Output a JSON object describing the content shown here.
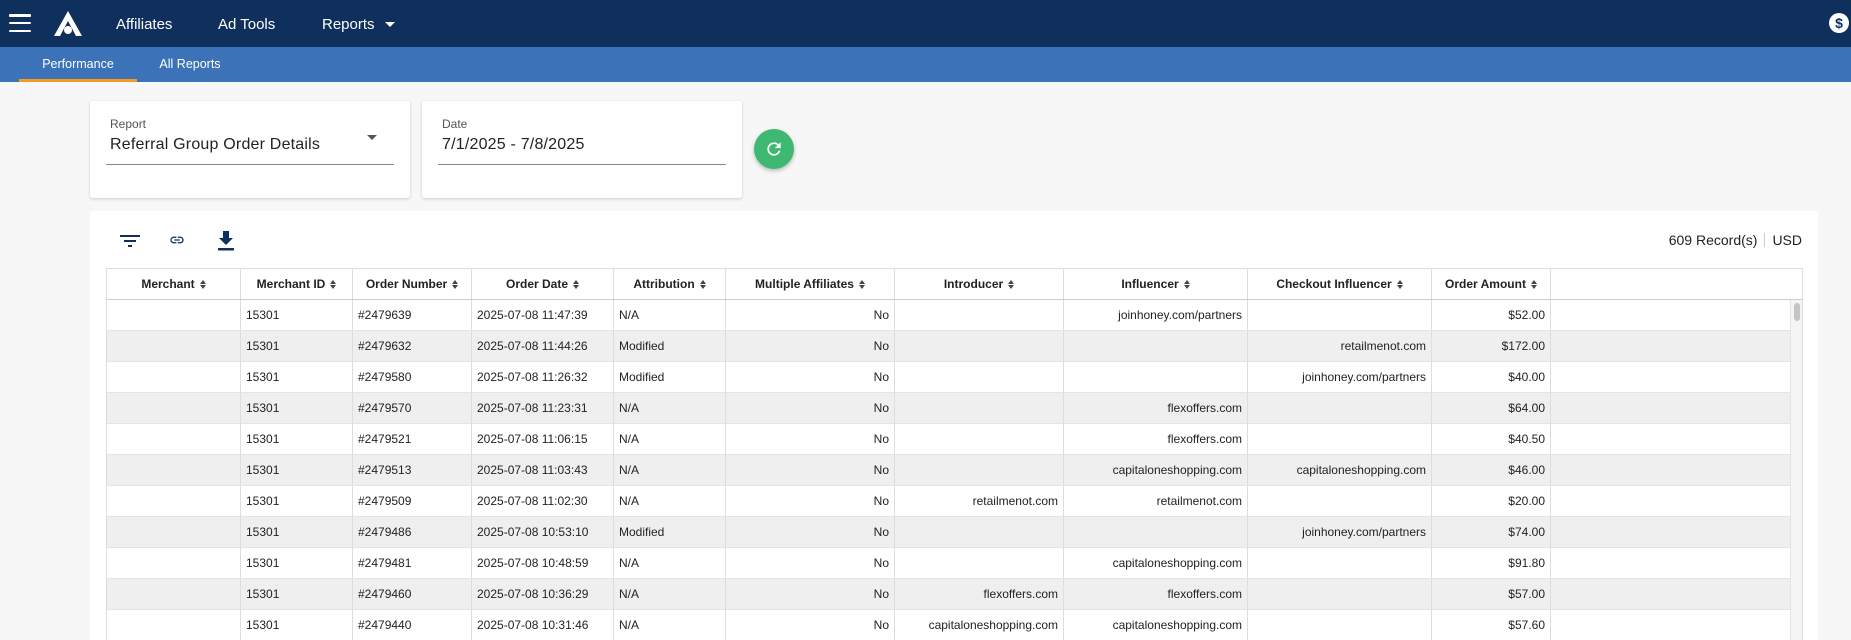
{
  "nav": {
    "items": [
      {
        "label": "Affiliates"
      },
      {
        "label": "Ad Tools"
      },
      {
        "label": "Reports"
      }
    ],
    "dollar_icon": "$"
  },
  "subnav": {
    "tabs": [
      {
        "label": "Performance",
        "active": true
      },
      {
        "label": "All Reports",
        "active": false
      }
    ]
  },
  "filters": {
    "report": {
      "label": "Report",
      "value": "Referral Group Order Details"
    },
    "date": {
      "label": "Date",
      "value": "7/1/2025 - 7/8/2025"
    }
  },
  "toolbar": {
    "icons": [
      "filter-icon",
      "link-icon",
      "download-icon"
    ],
    "records": "609 Record(s)",
    "currency": "USD"
  },
  "colors": {
    "topbar": "#0f2f5c",
    "subbar": "#3b72b8",
    "active_tab": "#f59a23",
    "refresh": "#3fb872"
  },
  "table": {
    "columns": [
      "Merchant",
      "Merchant ID",
      "Order Number",
      "Order Date",
      "Attribution",
      "Multiple Affiliates",
      "Introducer",
      "Influencer",
      "Checkout Influencer",
      "Order Amount"
    ],
    "rows": [
      [
        "",
        "15301",
        "#2479639",
        "2025-07-08 11:47:39",
        "N/A",
        "No",
        "",
        "joinhoney.com/partners",
        "",
        "$52.00"
      ],
      [
        "",
        "15301",
        "#2479632",
        "2025-07-08 11:44:26",
        "Modified",
        "No",
        "",
        "",
        "retailmenot.com",
        "$172.00"
      ],
      [
        "",
        "15301",
        "#2479580",
        "2025-07-08 11:26:32",
        "Modified",
        "No",
        "",
        "",
        "joinhoney.com/partners",
        "$40.00"
      ],
      [
        "",
        "15301",
        "#2479570",
        "2025-07-08 11:23:31",
        "N/A",
        "No",
        "",
        "flexoffers.com",
        "",
        "$64.00"
      ],
      [
        "",
        "15301",
        "#2479521",
        "2025-07-08 11:06:15",
        "N/A",
        "No",
        "",
        "flexoffers.com",
        "",
        "$40.50"
      ],
      [
        "",
        "15301",
        "#2479513",
        "2025-07-08 11:03:43",
        "N/A",
        "No",
        "",
        "capitaloneshopping.com",
        "capitaloneshopping.com",
        "$46.00"
      ],
      [
        "",
        "15301",
        "#2479509",
        "2025-07-08 11:02:30",
        "N/A",
        "No",
        "retailmenot.com",
        "retailmenot.com",
        "",
        "$20.00"
      ],
      [
        "",
        "15301",
        "#2479486",
        "2025-07-08 10:53:10",
        "Modified",
        "No",
        "",
        "",
        "joinhoney.com/partners",
        "$74.00"
      ],
      [
        "",
        "15301",
        "#2479481",
        "2025-07-08 10:48:59",
        "N/A",
        "No",
        "",
        "capitaloneshopping.com",
        "",
        "$91.80"
      ],
      [
        "",
        "15301",
        "#2479460",
        "2025-07-08 10:36:29",
        "N/A",
        "No",
        "flexoffers.com",
        "flexoffers.com",
        "",
        "$57.00"
      ],
      [
        "",
        "15301",
        "#2479440",
        "2025-07-08 10:31:46",
        "N/A",
        "No",
        "capitaloneshopping.com",
        "capitaloneshopping.com",
        "",
        "$57.60"
      ]
    ]
  }
}
